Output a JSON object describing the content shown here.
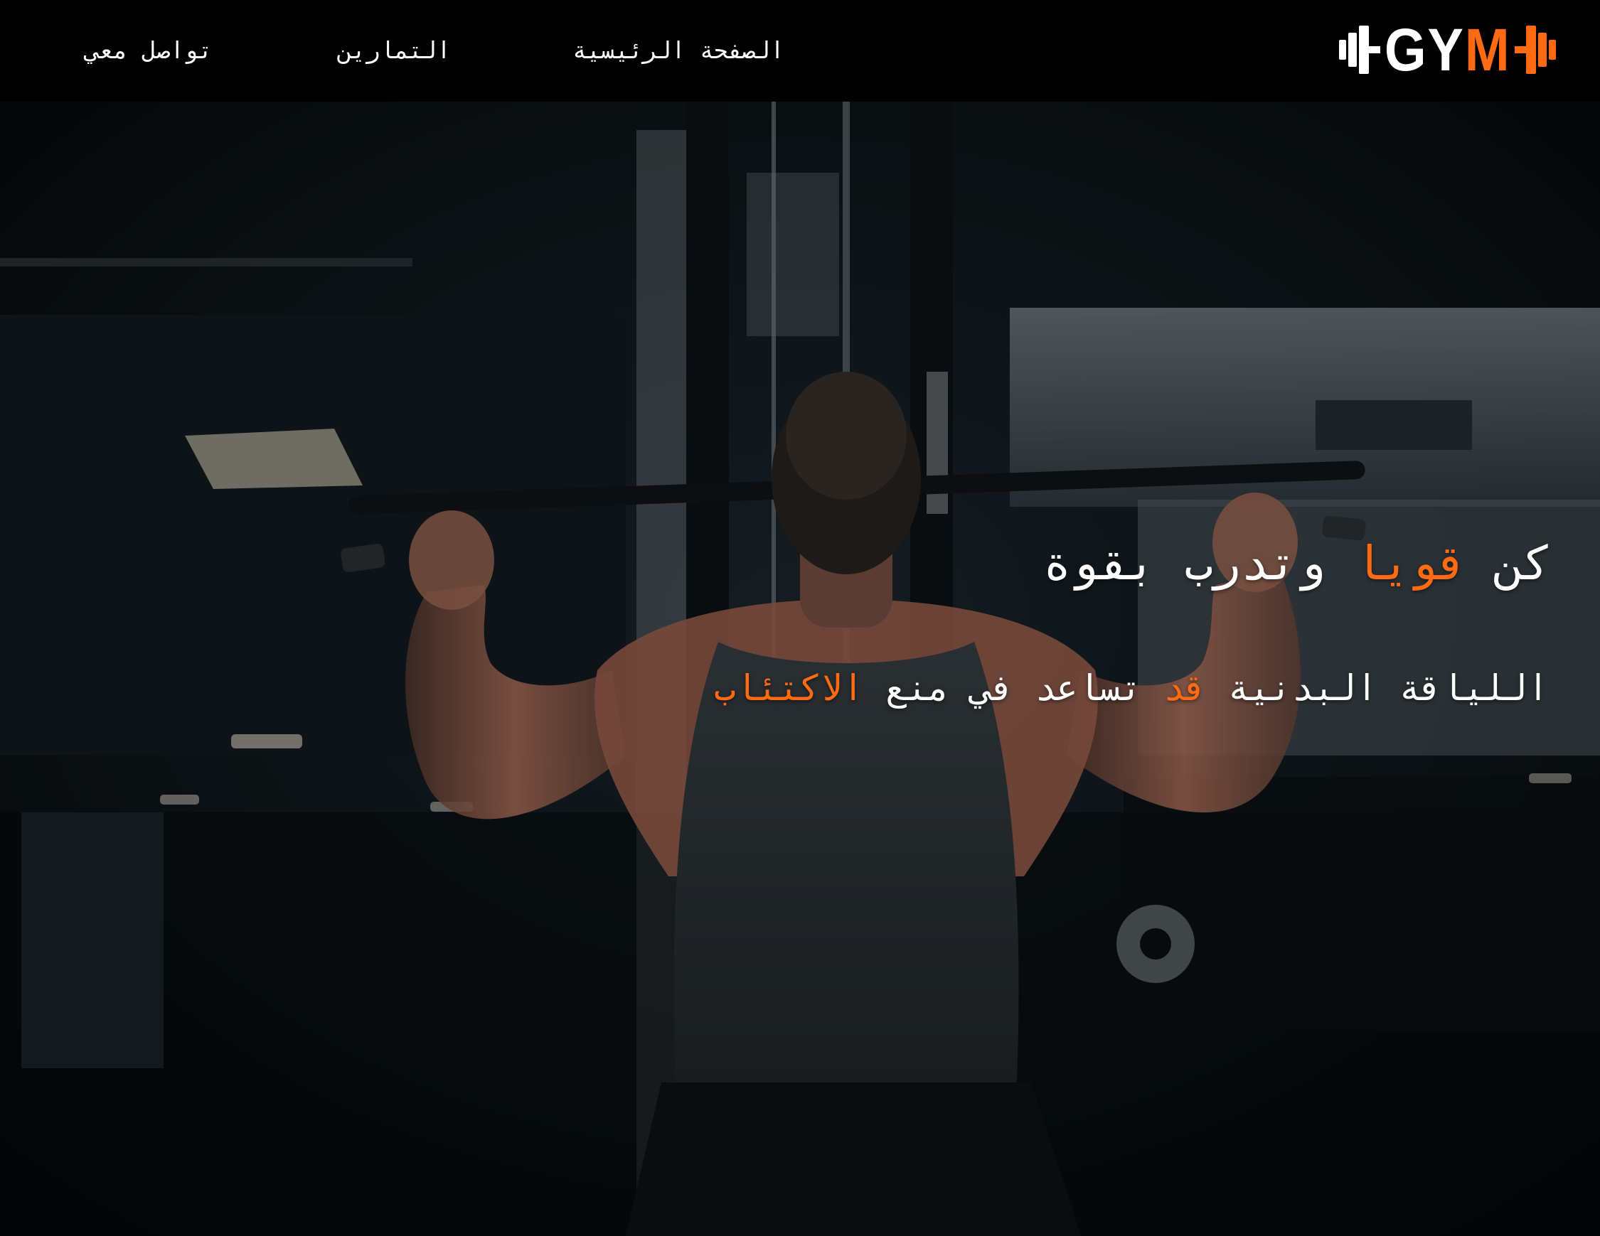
{
  "nav": {
    "links": [
      {
        "label": "تواصل معي"
      },
      {
        "label": "التمارين"
      },
      {
        "label": "الصفحة الرئيسية"
      }
    ]
  },
  "logo": {
    "text_white": "GY",
    "text_accent": "M"
  },
  "hero": {
    "headline": {
      "part1": "كن ",
      "accent": "قويا",
      "part2": " وتدرب بقوة"
    },
    "subline": {
      "part1": "اللياقة البدنية ",
      "accent1": "قد",
      "part2": " تساعد في منع ",
      "accent2": "الاكتئاب"
    }
  },
  "colors": {
    "accent": "#ff6a13",
    "nav_background": "#000000",
    "text": "#ffffff"
  },
  "icons": {
    "logo_left": "dumbbell-plate-icon",
    "logo_right": "dumbbell-plate-icon"
  }
}
